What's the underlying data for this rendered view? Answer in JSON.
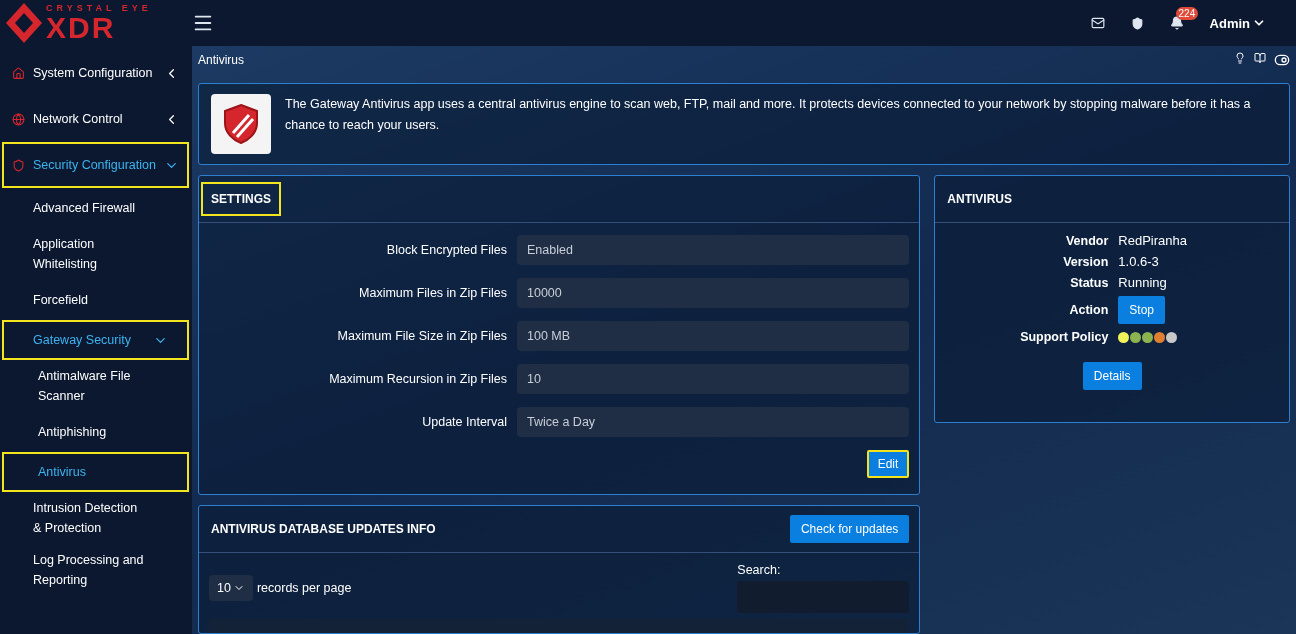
{
  "logo": {
    "top": "CRYSTAL EYE",
    "main": "XDR"
  },
  "header": {
    "notifications": "224",
    "user": "Admin"
  },
  "sidebar": {
    "items": [
      {
        "label": "System Configuration",
        "kind": "home",
        "expanded": false,
        "selected": false,
        "highlighted": false
      },
      {
        "label": "Network Control",
        "kind": "globe",
        "expanded": false,
        "selected": false,
        "highlighted": false
      },
      {
        "label": "Security Configuration",
        "kind": "shield",
        "expanded": true,
        "selected": true,
        "highlighted": true,
        "children": [
          {
            "label": "Advanced Firewall",
            "selected": false,
            "highlighted": false
          },
          {
            "label": "Application Whitelisting",
            "selected": false,
            "highlighted": false
          },
          {
            "label": "Forcefield",
            "selected": false,
            "highlighted": false
          },
          {
            "label": "Gateway Security",
            "selected": true,
            "highlighted": true,
            "expanded": true,
            "children": [
              {
                "label": "Antimalware File Scanner",
                "selected": false,
                "highlighted": false
              },
              {
                "label": "Antiphishing",
                "selected": false,
                "highlighted": false
              },
              {
                "label": "Antivirus",
                "selected": true,
                "highlighted": true
              }
            ]
          },
          {
            "label": "Intrusion Detection & Protection",
            "selected": false,
            "highlighted": false
          },
          {
            "label": "Log Processing and Reporting",
            "selected": false,
            "highlighted": false
          }
        ]
      }
    ]
  },
  "breadcrumb": "Antivirus",
  "intro": "The Gateway Antivirus app uses a central antivirus engine to scan web, FTP, mail and more. It protects devices connected to your network by stopping malware before it has a chance to reach your users.",
  "settings": {
    "title": "SETTINGS",
    "highlighted": true,
    "fields": [
      {
        "label": "Block Encrypted Files",
        "value": "Enabled"
      },
      {
        "label": "Maximum Files in Zip Files",
        "value": "10000"
      },
      {
        "label": "Maximum File Size in Zip Files",
        "value": "100 MB"
      },
      {
        "label": "Maximum Recursion in Zip Files",
        "value": "10"
      },
      {
        "label": "Update Interval",
        "value": "Twice a Day"
      }
    ],
    "edit": {
      "label": "Edit",
      "highlighted": true
    }
  },
  "info": {
    "title": "ANTIVIRUS",
    "rows": [
      {
        "kind": "text",
        "label": "Vendor",
        "value": "RedPiranha"
      },
      {
        "kind": "text",
        "label": "Version",
        "value": "1.0.6-3"
      },
      {
        "kind": "text",
        "label": "Status",
        "value": "Running"
      },
      {
        "kind": "button",
        "label": "Action",
        "value": "Stop"
      },
      {
        "kind": "dots",
        "label": "Support Policy",
        "dots": [
          {
            "color": "#f2f25a"
          },
          {
            "color": "#8cb350"
          },
          {
            "color": "#8cb350"
          },
          {
            "color": "#e07f30"
          },
          {
            "color": "#c8c8c8"
          }
        ]
      }
    ],
    "details": "Details"
  },
  "updates": {
    "title": "ANTIVIRUS DATABASE UPDATES INFO",
    "check": "Check for updates",
    "page_size": "10",
    "records_label": "records per page",
    "search_label": "Search:"
  }
}
